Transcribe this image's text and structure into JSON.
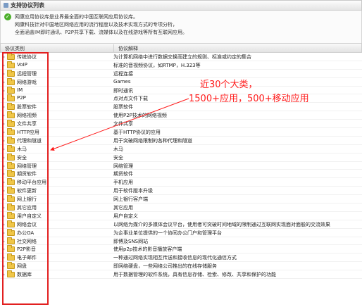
{
  "panel": {
    "title": "支持协议列表"
  },
  "info": {
    "line1": "网康应用协议库是业界最全面的中国互联网应用协议库。",
    "line2": "网康科技针对中国地区网络应用的流行程度以及技术实现方式的专项分析，",
    "line3": "全面涵盖IM即时通讯、P2P共享下载、流媒体以及在线游戏等所有互联网应用。"
  },
  "table": {
    "col_category": "协议类别",
    "col_desc": "协议解释",
    "rows": [
      {
        "name": "传统协议",
        "desc": "为计算机网络中进行数据交换而建立的规则、标准或约定的集合"
      },
      {
        "name": "VoIP",
        "desc": "标准的音视频协议，如RTMP，H.323等"
      },
      {
        "name": "远程管理",
        "desc": "远程连接"
      },
      {
        "name": "网络游戏",
        "desc": "Games"
      },
      {
        "name": "IM",
        "desc": "即时通讯"
      },
      {
        "name": "P2P",
        "desc": "点对点文件下载"
      },
      {
        "name": "股票软件",
        "desc": "股票软件"
      },
      {
        "name": "网络视频",
        "desc": "使用P2P技术的网络视频"
      },
      {
        "name": "文件共享",
        "desc": "文件共享"
      },
      {
        "name": "HTTP应用",
        "desc": "基于HTTP协议的应用"
      },
      {
        "name": "代理和隧道",
        "desc": "用于突破网络限制的各种代理和隧道"
      },
      {
        "name": "木马",
        "desc": "木马"
      },
      {
        "name": "安全",
        "desc": "安全"
      },
      {
        "name": "网络管理",
        "desc": "网络管理"
      },
      {
        "name": "期货软件",
        "desc": "期货软件"
      },
      {
        "name": "移动平台应用",
        "desc": "手机应用"
      },
      {
        "name": "软件更新",
        "desc": "用于软件版本升级"
      },
      {
        "name": "网上银行",
        "desc": "网上银行客户端"
      },
      {
        "name": "其它应用",
        "desc": "其它应用"
      },
      {
        "name": "用户自定义",
        "desc": "用户自定义"
      },
      {
        "name": "网络会议",
        "desc": "以网络为媒介的多媒体会议平台，使用者可突破时间地域的限制通过互联网实现面对面般的交流效果"
      },
      {
        "name": "办公OA",
        "desc": "为企事业单位提供的一个协同办公门户和管理平台"
      },
      {
        "name": "社交网络",
        "desc": "即博及SNS网站"
      },
      {
        "name": "P2P影音",
        "desc": "使用p2p技术的影音播放客户端"
      },
      {
        "name": "电子邮件",
        "desc": "一种通过网络实现相互传送和接收信息的现代化通信方式"
      },
      {
        "name": "网盘",
        "desc": "即网络硬盘，一些网络公司推出的在线存储服务"
      },
      {
        "name": "数据库",
        "desc": "用于数据管理的软件系统，具有信息存储、检索、修改、共享和保护的功能"
      }
    ]
  },
  "annotation": {
    "line1": "近30个大类，",
    "line2": "1500+应用，500+移动应用"
  },
  "colors": {
    "annotation": "#ff1a1a",
    "folder": "#f0c648",
    "check": "#4caf2a"
  }
}
